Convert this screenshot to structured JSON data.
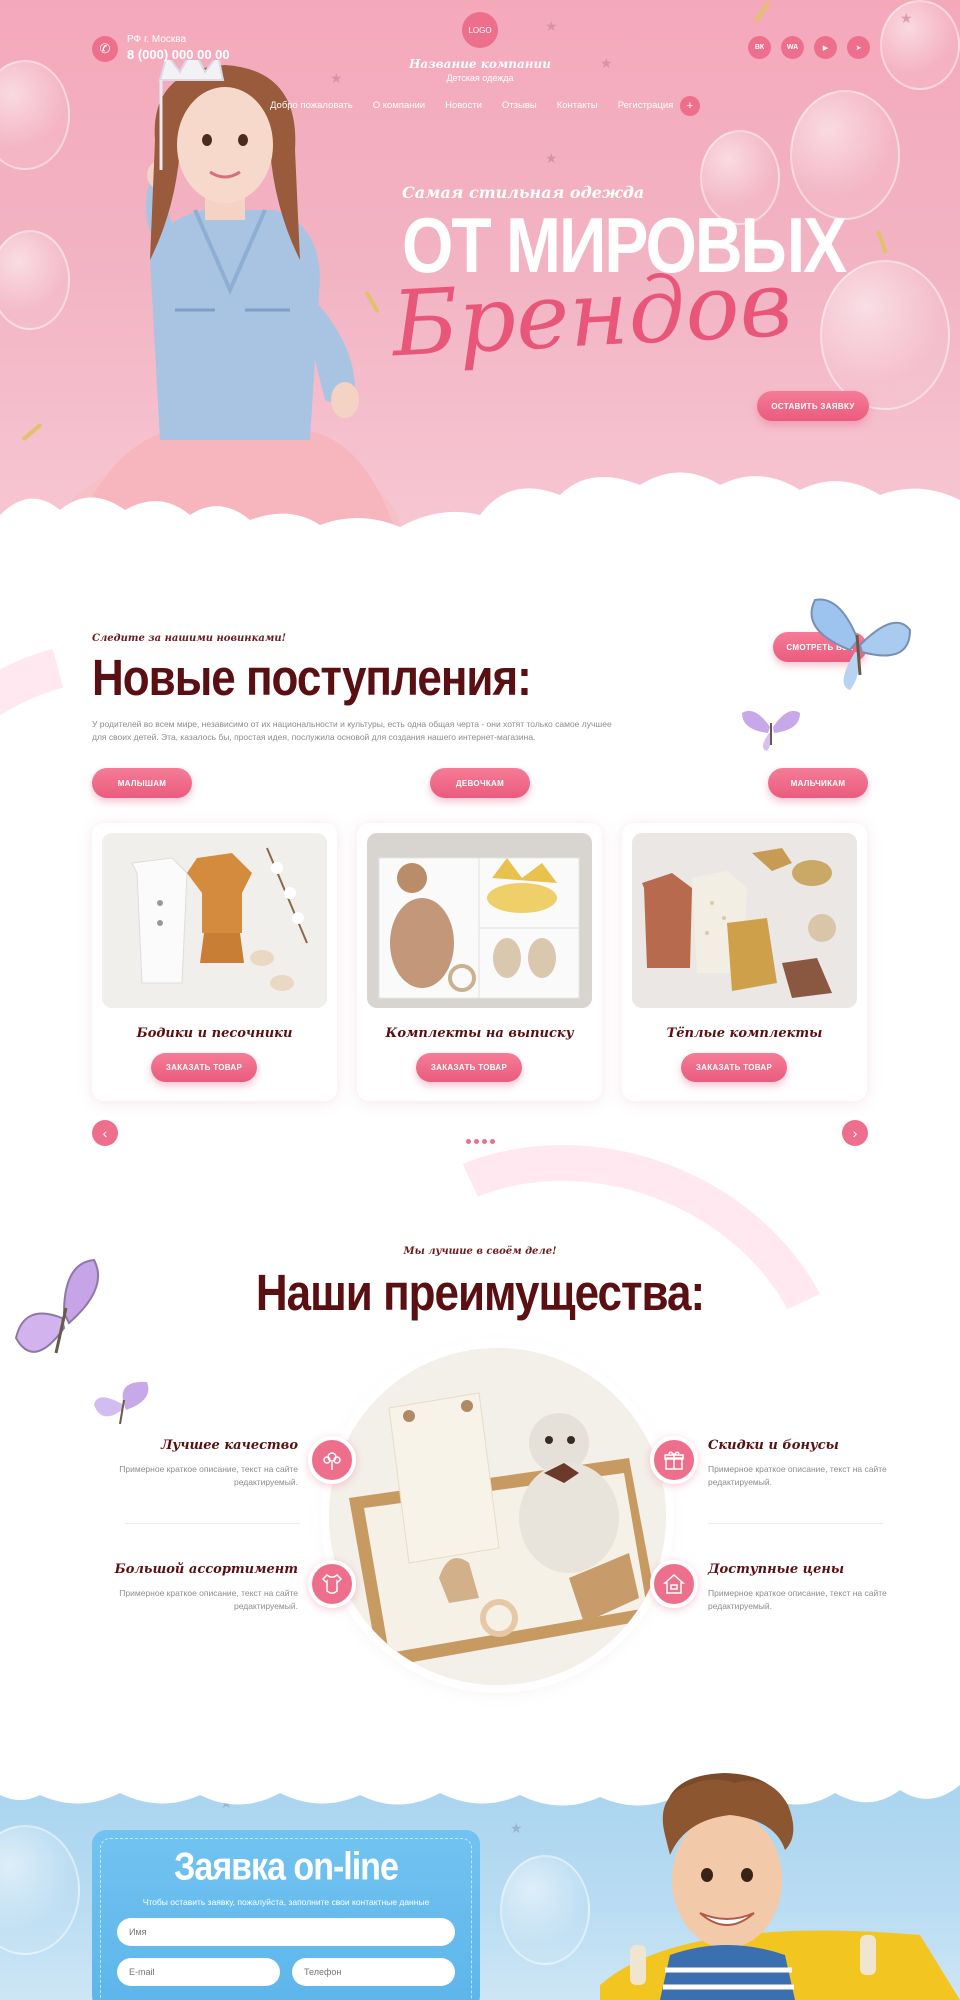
{
  "header": {
    "city": "РФ г. Москва",
    "phone": "8 (000) 000 00 00",
    "logo": "LOGO",
    "company_name": "Название компании",
    "company_sub": "Детская одежда",
    "socials": [
      "vk-icon",
      "whatsapp-icon",
      "youtube-icon",
      "telegram-icon"
    ],
    "social_labels": [
      "ВК",
      "WA",
      "▶",
      "➤"
    ],
    "nav": [
      "Добро пожаловать",
      "О компании",
      "Новости",
      "Отзывы",
      "Контакты",
      "Регистрация"
    ],
    "nav_plus": "+"
  },
  "hero": {
    "subtitle": "Самая стильная одежда",
    "title": "ОТ МИРОВЫХ",
    "script": "Брендов",
    "button": "оставить заявку"
  },
  "new_arrivals": {
    "kicker": "Следите за нашими новинками!",
    "title": "Новые поступления:",
    "description": "У родителей во всем мире, независимо от их национальности и культуры, есть одна общая черта - они хотят только самое лучшее для своих детей. Эта, казалось бы, простая идея, послужила основой для создания нашего интернет-магазина.",
    "see_all": "смотреть все",
    "categories": [
      "малышам",
      "девочкам",
      "мальчикам"
    ],
    "cards": [
      {
        "name": "Бодики и песочники",
        "button": "заказать товар"
      },
      {
        "name": "Комплекты на выписку",
        "button": "заказать товар"
      },
      {
        "name": "Тёплые комплекты",
        "button": "заказать товар"
      }
    ],
    "prev": "‹",
    "next": "›"
  },
  "advantages": {
    "kicker": "Мы лучшие в своём деле!",
    "title": "Наши преимущества:",
    "items": [
      {
        "name": "Лучшее качество",
        "desc": "Примерное краткое описание, текст на сайте редактируемый."
      },
      {
        "name": "Большой ассортимент",
        "desc": "Примерное краткое описание, текст на сайте редактируемый."
      },
      {
        "name": "Скидки и бонусы",
        "desc": "Примерное краткое описание, текст на сайте редактируемый."
      },
      {
        "name": "Доступные цены",
        "desc": "Примерное краткое описание, текст на сайте редактируемый."
      }
    ]
  },
  "form": {
    "title": "Заявка on-line",
    "desc": "Чтобы оставить заявку, пожалуйста, заполните свои контактные данные",
    "name_placeholder": "Имя",
    "email_placeholder": "E-mail",
    "phone_placeholder": "Телефон"
  },
  "colors": {
    "accent": "#ee6f8c",
    "heading": "#5a0f12",
    "hero_bg": "#f2b3c3",
    "form_bg": "#5cb5ea"
  }
}
